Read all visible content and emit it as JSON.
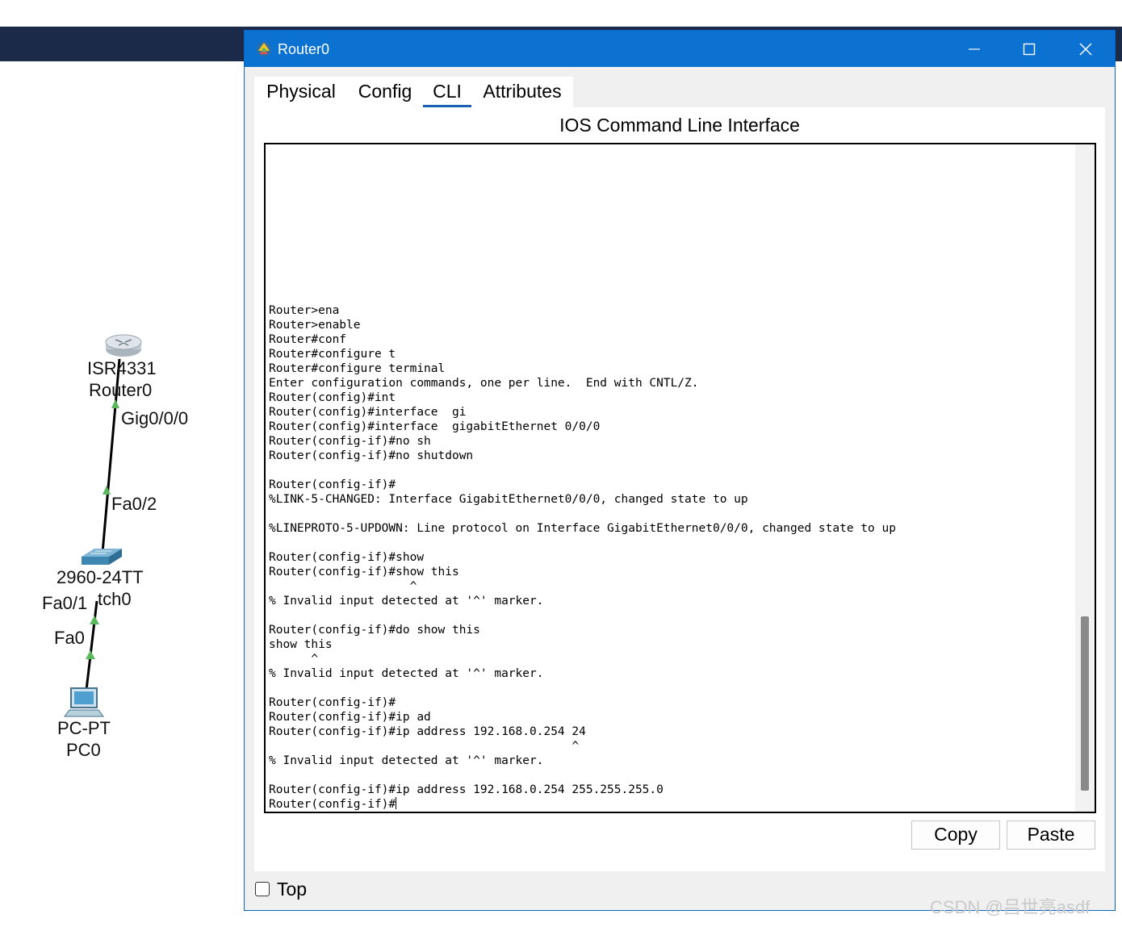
{
  "topology": {
    "router": {
      "model": "ISR4331",
      "name": "Router0",
      "port": "Gig0/0/0"
    },
    "switch": {
      "model": "2960-24TT",
      "name_fragment": "tch0",
      "port_up": "Fa0/2",
      "port_down": "Fa0/1"
    },
    "pc": {
      "model": "PC-PT",
      "name": "PC0",
      "port": "Fa0"
    },
    "link_color": "#000000",
    "link_up_color": "#5cb85c"
  },
  "window": {
    "title": "Router0",
    "controls": {
      "minimize": "—",
      "maximize": "☐",
      "close": "✕"
    },
    "tabs": [
      {
        "label": "Physical",
        "active": false
      },
      {
        "label": "Config",
        "active": false
      },
      {
        "label": "CLI",
        "active": true
      },
      {
        "label": "Attributes",
        "active": false
      }
    ],
    "panel_title": "IOS Command Line Interface",
    "terminal_lines": [
      "Router>ena",
      "Router>enable",
      "Router#conf",
      "Router#configure t",
      "Router#configure terminal",
      "Enter configuration commands, one per line.  End with CNTL/Z.",
      "Router(config)#int",
      "Router(config)#interface  gi",
      "Router(config)#interface  gigabitEthernet 0/0/0",
      "Router(config-if)#no sh",
      "Router(config-if)#no shutdown",
      "",
      "Router(config-if)#",
      "%LINK-5-CHANGED: Interface GigabitEthernet0/0/0, changed state to up",
      "",
      "%LINEPROTO-5-UPDOWN: Line protocol on Interface GigabitEthernet0/0/0, changed state to up",
      "",
      "Router(config-if)#show",
      "Router(config-if)#show this",
      "                    ^",
      "% Invalid input detected at '^' marker.",
      "",
      "Router(config-if)#do show this",
      "show this",
      "      ^",
      "% Invalid input detected at '^' marker.",
      "",
      "Router(config-if)#",
      "Router(config-if)#ip ad",
      "Router(config-if)#ip address 192.168.0.254 24",
      "                                           ^",
      "% Invalid input detected at '^' marker.",
      "",
      "Router(config-if)#ip address 192.168.0.254 255.255.255.0",
      "Router(config-if)#"
    ],
    "copy_label": "Copy",
    "paste_label": "Paste",
    "top_checkbox": {
      "label": "Top",
      "checked": false
    }
  },
  "watermark": "CSDN @吕世亮asdf",
  "colors": {
    "title_bar": "#0b72d1",
    "top_bar": "#1b2a48",
    "active_tab_underline": "#1a5fb4"
  }
}
